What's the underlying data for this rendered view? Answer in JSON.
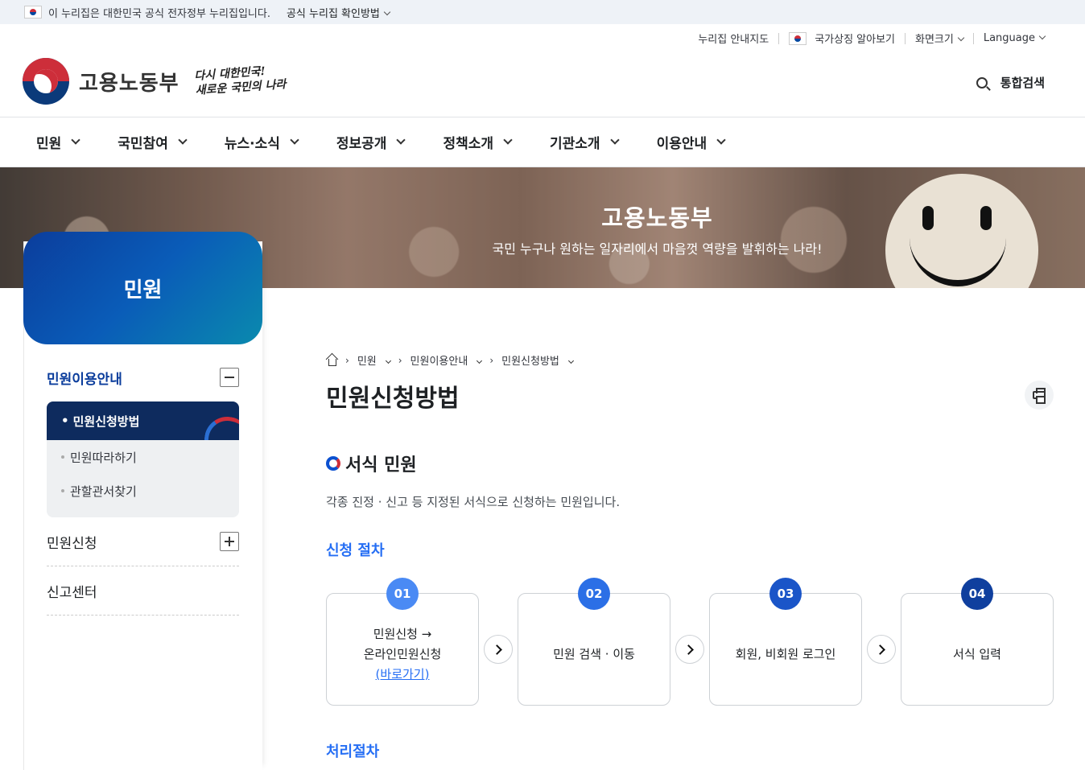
{
  "gov_banner": {
    "text": "이 누리집은 대한민국 공식 전자정부 누리집입니다.",
    "check_link": "공식 누리집 확인방법"
  },
  "utility": {
    "sitemap": "누리집 안내지도",
    "symbol": "국가상징 알아보기",
    "fontsize": "화면크기",
    "language": "Language"
  },
  "header": {
    "logo_text": "고용노동부",
    "slogan_line1": "다시 대한민국!",
    "slogan_line2": "새로운 국민의 나라",
    "search_label": "통합검색"
  },
  "gnb": [
    "민원",
    "국민참여",
    "뉴스·소식",
    "정보공개",
    "정책소개",
    "기관소개",
    "이용안내"
  ],
  "visual": {
    "title": "고용노동부",
    "subtitle": "국민 누구나 원하는 일자리에서 마음껏 역량을 발휘하는 나라!"
  },
  "sidebar": {
    "title": "민원",
    "group1": "민원이용안내",
    "active": "민원신청방법",
    "sub_items": [
      "민원따라하기",
      "관할관서찾기"
    ],
    "group2": "민원신청",
    "group3": "신고센터"
  },
  "breadcrumb": [
    "민원",
    "민원이용안내",
    "민원신청방법"
  ],
  "content": {
    "page_title": "민원신청방법",
    "section_title": "서식 민원",
    "section_desc": "각종 진정 · 신고 등 지정된 서식으로 신청하는 민원입니다.",
    "procedure_title": "신청 절차",
    "process_title": "처리절차",
    "steps": [
      {
        "num": "01",
        "line1": "민원신청 →",
        "line2": "온라인민원신청",
        "link": "(바로가기)",
        "color": "#4a8af4"
      },
      {
        "num": "02",
        "line1": "민원 검색 · 이동",
        "color": "#2b6fe6"
      },
      {
        "num": "03",
        "line1": "회원, 비회원 로그인",
        "color": "#1a55c8"
      },
      {
        "num": "04",
        "line1": "서식 입력",
        "color": "#0f3f9e"
      }
    ]
  }
}
